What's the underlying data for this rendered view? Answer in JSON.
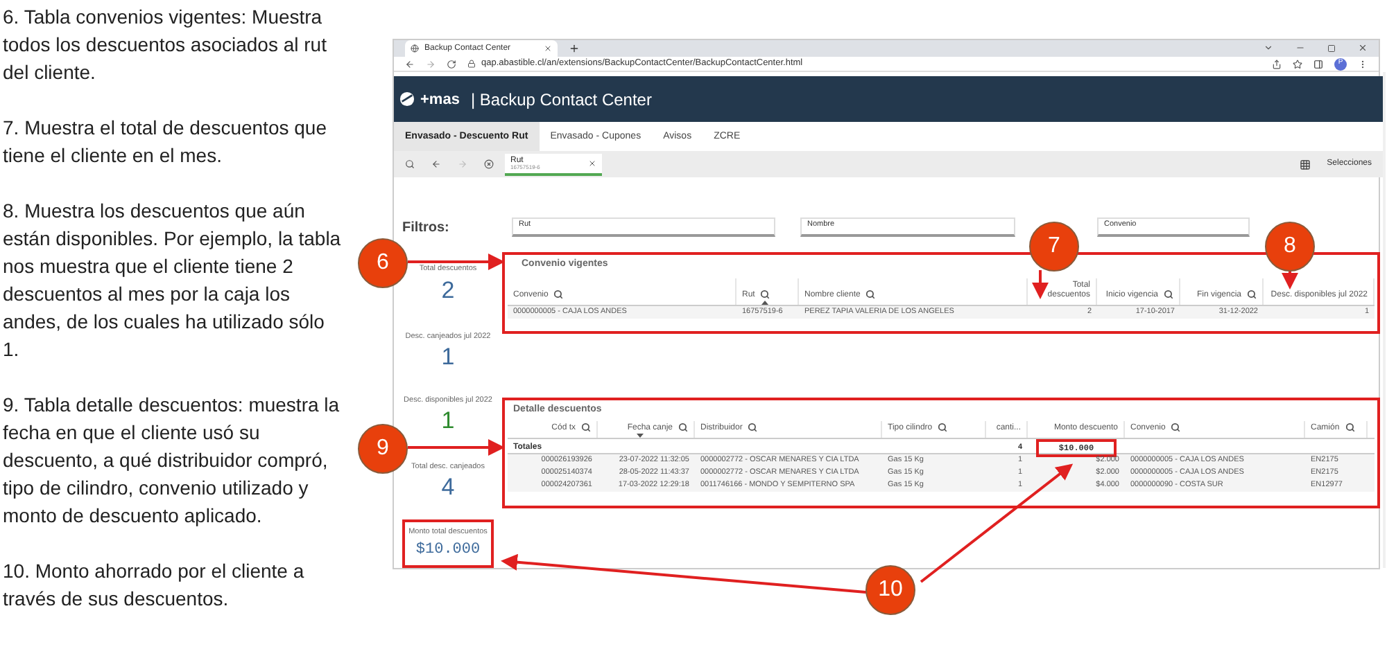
{
  "notes": [
    "6. Tabla convenios vigentes: Muestra todos los descuentos asociados al rut del cliente.",
    "7. Muestra el total de descuentos que tiene el cliente en el mes.",
    "8. Muestra los descuentos que aún están disponibles. Por ejemplo, la tabla nos muestra que el cliente tiene 2 descuentos al mes por la caja los andes, de los cuales ha utilizado sólo 1.",
    "9. Tabla detalle descuentos: muestra la fecha en que el cliente usó su descuento, a qué distribuidor compró, tipo de cilindro, convenio utilizado y monto de descuento aplicado.",
    "10. Monto ahorrado por el cliente a través de sus descuentos."
  ],
  "browser": {
    "tab_title": "Backup Contact Center",
    "url": "qap.abastible.cl/an/extensions/BackupContactCenter/BackupContactCenter.html",
    "profile": "P"
  },
  "app": {
    "logo": "+mas",
    "title": "| Backup Contact Center",
    "tabs": [
      {
        "label": "Envasado - Descuento Rut",
        "selected": true
      },
      {
        "label": "Envasado - Cupones",
        "selected": false
      },
      {
        "label": "Avisos",
        "selected": false
      },
      {
        "label": "ZCRE",
        "selected": false
      }
    ],
    "selection": {
      "field": "Rut",
      "value": "16757519-6"
    },
    "selections_label": "Selecciones",
    "filters_label": "Filtros:",
    "filters": [
      "Rut",
      "Nombre",
      "Convenio"
    ],
    "kpis": [
      {
        "label": "Total descuentos",
        "value": "2",
        "color": "#3d6a9b"
      },
      {
        "label": "Desc. canjeados jul 2022",
        "value": "1",
        "color": "#3d6a9b"
      },
      {
        "label": "Desc. disponibles jul 2022",
        "value": "1",
        "color": "#2e8b2e"
      },
      {
        "label": "Total desc. canjeados",
        "value": "4",
        "color": "#3d6a9b"
      },
      {
        "label": "Monto total descuentos",
        "value": "$10.000",
        "color": "#3d6a9b"
      }
    ],
    "convenios": {
      "title": "Convenio vigentes",
      "columns": [
        {
          "label": "Convenio",
          "searchable": true,
          "sort_up": false,
          "sort_down": false
        },
        {
          "label": "Rut",
          "searchable": true,
          "sort_up": true,
          "sort_down": false
        },
        {
          "label": "Nombre cliente",
          "searchable": true,
          "sort_up": false,
          "sort_down": false
        },
        {
          "label": "Total descuentos",
          "searchable": false,
          "sort_up": false,
          "sort_down": false
        },
        {
          "label": "Inicio vigencia",
          "searchable": true,
          "sort_up": false,
          "sort_down": false
        },
        {
          "label": "Fin vigencia",
          "searchable": true,
          "sort_up": false,
          "sort_down": false
        },
        {
          "label": "Desc. disponibles jul 2022",
          "searchable": false,
          "sort_up": false,
          "sort_down": false
        }
      ],
      "rows": [
        [
          "0000000005 - CAJA LOS ANDES",
          "16757519-6",
          "PEREZ TAPIA VALERIA DE LOS ANGELES",
          "2",
          "17-10-2017",
          "31-12-2022",
          "1"
        ]
      ]
    },
    "detalle": {
      "title": "Detalle descuentos",
      "columns": [
        {
          "label": "Cód tx",
          "searchable": true,
          "sort_up": false,
          "sort_down": false
        },
        {
          "label": "Fecha canje",
          "searchable": true,
          "sort_up": false,
          "sort_down": true
        },
        {
          "label": "Distribuidor",
          "searchable": true,
          "sort_up": false,
          "sort_down": false
        },
        {
          "label": "Tipo cilindro",
          "searchable": true,
          "sort_up": false,
          "sort_down": false
        },
        {
          "label": "canti...",
          "searchable": false,
          "sort_up": false,
          "sort_down": false
        },
        {
          "label": "Monto descuento",
          "searchable": false,
          "sort_up": false,
          "sort_down": false
        },
        {
          "label": "Convenio",
          "searchable": true,
          "sort_up": false,
          "sort_down": false
        },
        {
          "label": "Camión",
          "searchable": true,
          "sort_up": false,
          "sort_down": false
        }
      ],
      "totals": {
        "label": "Totales",
        "quantity": "4",
        "amount": "$10.000"
      },
      "rows": [
        [
          "000026193926",
          "23-07-2022 11:32:05",
          "0000002772 - OSCAR MENARES Y CIA LTDA",
          "Gas 15 Kg",
          "1",
          "$2.000",
          "0000000005 - CAJA LOS ANDES",
          "EN2175"
        ],
        [
          "000025140374",
          "28-05-2022 11:43:37",
          "0000002772 - OSCAR MENARES Y CIA LTDA",
          "Gas 15 Kg",
          "1",
          "$2.000",
          "0000000005 - CAJA LOS ANDES",
          "EN2175"
        ],
        [
          "000024207361",
          "17-03-2022 12:29:18",
          "0011746166 - MONDO Y SEMPITERNO SPA",
          "Gas 15 Kg",
          "1",
          "$4.000",
          "0000000090 - COSTA SUR",
          "EN12977"
        ]
      ]
    }
  },
  "callouts": [
    "6",
    "7",
    "8",
    "9",
    "10"
  ]
}
